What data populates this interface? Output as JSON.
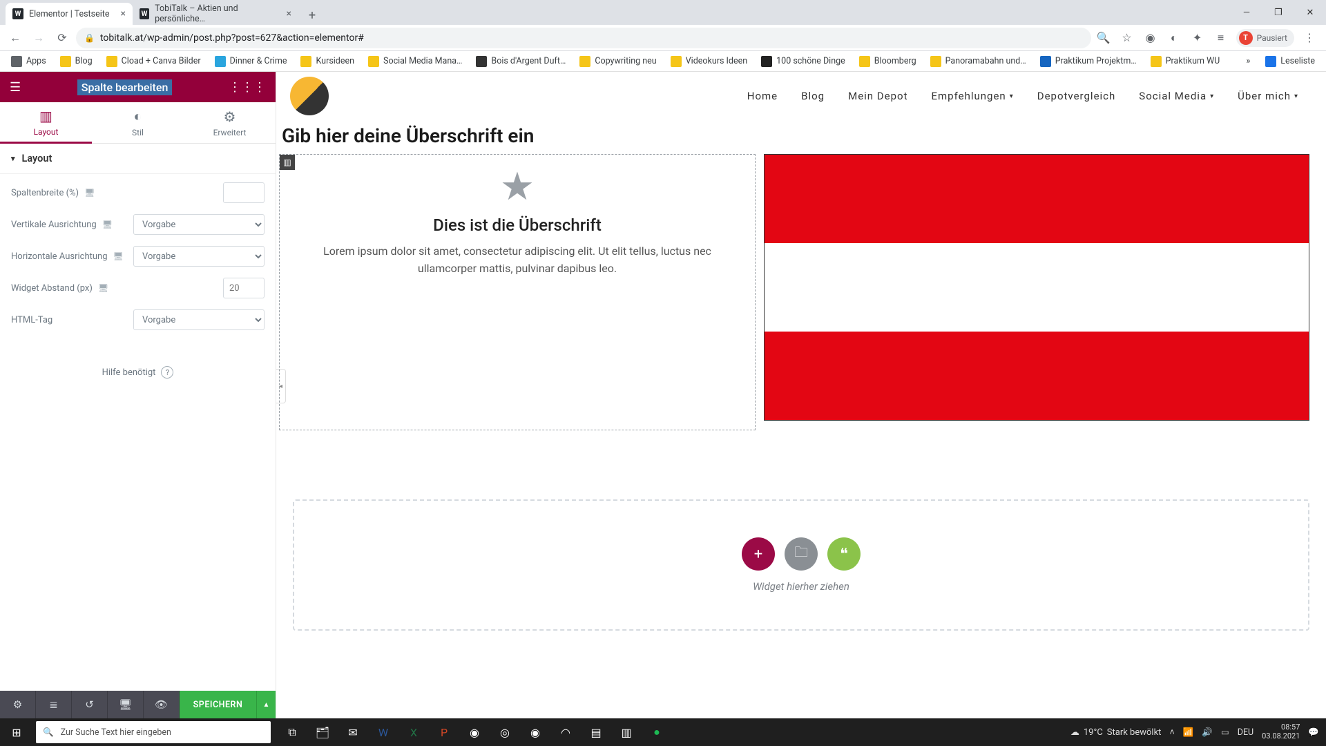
{
  "browser": {
    "tabs": [
      {
        "title": "Elementor | Testseite",
        "active": true
      },
      {
        "title": "TobiTalk – Aktien und persönliche…",
        "active": false
      }
    ],
    "url": "tobitalk.at/wp-admin/post.php?post=627&action=elementor#",
    "profile_label": "Pausiert",
    "profile_initial": "T"
  },
  "bookmarks": {
    "items": [
      "Apps",
      "Blog",
      "Cload + Canva Bilder",
      "Dinner & Crime",
      "Kursideen",
      "Social Media Mana…",
      "Bois d'Argent Duft…",
      "Copywriting neu",
      "Videokurs Ideen",
      "100 schöne Dinge",
      "Bloomberg",
      "Panoramabahn und…",
      "Praktikum Projektm…",
      "Praktikum WU"
    ],
    "overflow": "»",
    "readlist": "Leseliste"
  },
  "panel": {
    "title": "Spalte bearbeiten",
    "tabs": {
      "layout": "Layout",
      "style": "Stil",
      "advanced": "Erweitert"
    },
    "section": "Layout",
    "controls": {
      "col_width": {
        "label": "Spaltenbreite (%)"
      },
      "valign": {
        "label": "Vertikale Ausrichtung",
        "value": "Vorgabe"
      },
      "halign": {
        "label": "Horizontale Ausrichtung",
        "value": "Vorgabe"
      },
      "widget_gap": {
        "label": "Widget Abstand (px)",
        "placeholder": "20"
      },
      "html_tag": {
        "label": "HTML-Tag",
        "value": "Vorgabe"
      }
    },
    "help": "Hilfe benötigt",
    "save": "SPEICHERN"
  },
  "site": {
    "nav": [
      "Home",
      "Blog",
      "Mein Depot",
      "Empfehlungen",
      "Depotvergleich",
      "Social Media",
      "Über mich"
    ],
    "nav_has_caret": [
      false,
      false,
      false,
      true,
      false,
      true,
      true
    ],
    "heading": "Gib hier deine Überschrift ein",
    "iconbox": {
      "title": "Dies ist die Überschrift",
      "text": "Lorem ipsum dolor sit amet, consectetur adipiscing elit. Ut elit tellus, luctus nec ullamcorper mattis, pulvinar dapibus leo."
    },
    "dropzone_text": "Widget hierher ziehen"
  },
  "taskbar": {
    "search_placeholder": "Zur Suche Text hier eingeben",
    "weather": {
      "temp": "19°C",
      "cond": "Stark bewölkt"
    },
    "lang": "DEU",
    "time": "08:57",
    "date": "03.08.2021"
  }
}
